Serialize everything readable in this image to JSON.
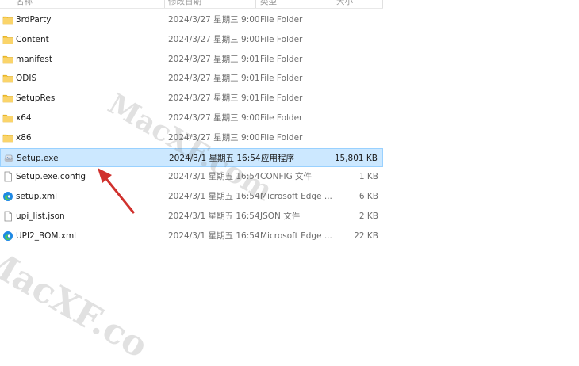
{
  "header": {
    "col_name": "名称",
    "col_date": "修改日期",
    "col_type": "类型",
    "col_size": "大小"
  },
  "files": [
    {
      "name": "3rdParty",
      "date": "2024/3/27 星期三 9:00",
      "type": "File Folder",
      "size": "",
      "icon": "folder-icon"
    },
    {
      "name": "Content",
      "date": "2024/3/27 星期三 9:00",
      "type": "File Folder",
      "size": "",
      "icon": "folder-icon"
    },
    {
      "name": "manifest",
      "date": "2024/3/27 星期三 9:01",
      "type": "File Folder",
      "size": "",
      "icon": "folder-icon"
    },
    {
      "name": "ODIS",
      "date": "2024/3/27 星期三 9:01",
      "type": "File Folder",
      "size": "",
      "icon": "folder-icon"
    },
    {
      "name": "SetupRes",
      "date": "2024/3/27 星期三 9:01",
      "type": "File Folder",
      "size": "",
      "icon": "folder-icon"
    },
    {
      "name": "x64",
      "date": "2024/3/27 星期三 9:00",
      "type": "File Folder",
      "size": "",
      "icon": "folder-icon"
    },
    {
      "name": "x86",
      "date": "2024/3/27 星期三 9:00",
      "type": "File Folder",
      "size": "",
      "icon": "folder-icon"
    },
    {
      "name": "Setup.exe",
      "date": "2024/3/1 星期五 16:54",
      "type": "应用程序",
      "size": "15,801 KB",
      "icon": "installer-icon",
      "selected": true
    },
    {
      "name": "Setup.exe.config",
      "date": "2024/3/1 星期五 16:54",
      "type": "CONFIG 文件",
      "size": "1 KB",
      "icon": "file-icon"
    },
    {
      "name": "setup.xml",
      "date": "2024/3/1 星期五 16:54",
      "type": "Microsoft Edge ...",
      "size": "6 KB",
      "icon": "edge-icon"
    },
    {
      "name": "upi_list.json",
      "date": "2024/3/1 星期五 16:54",
      "type": "JSON 文件",
      "size": "2 KB",
      "icon": "file-icon"
    },
    {
      "name": "UPI2_BOM.xml",
      "date": "2024/3/1 星期五 16:54",
      "type": "Microsoft Edge ...",
      "size": "22 KB",
      "icon": "edge-icon"
    }
  ],
  "watermarks": [
    "MacXF.com",
    "MacXF.co"
  ],
  "colors": {
    "selection_bg": "#cce8ff",
    "selection_border": "#99d1ff",
    "folder": "#f7c843",
    "arrow": "#d0312d",
    "edge": "#1e88e5"
  }
}
